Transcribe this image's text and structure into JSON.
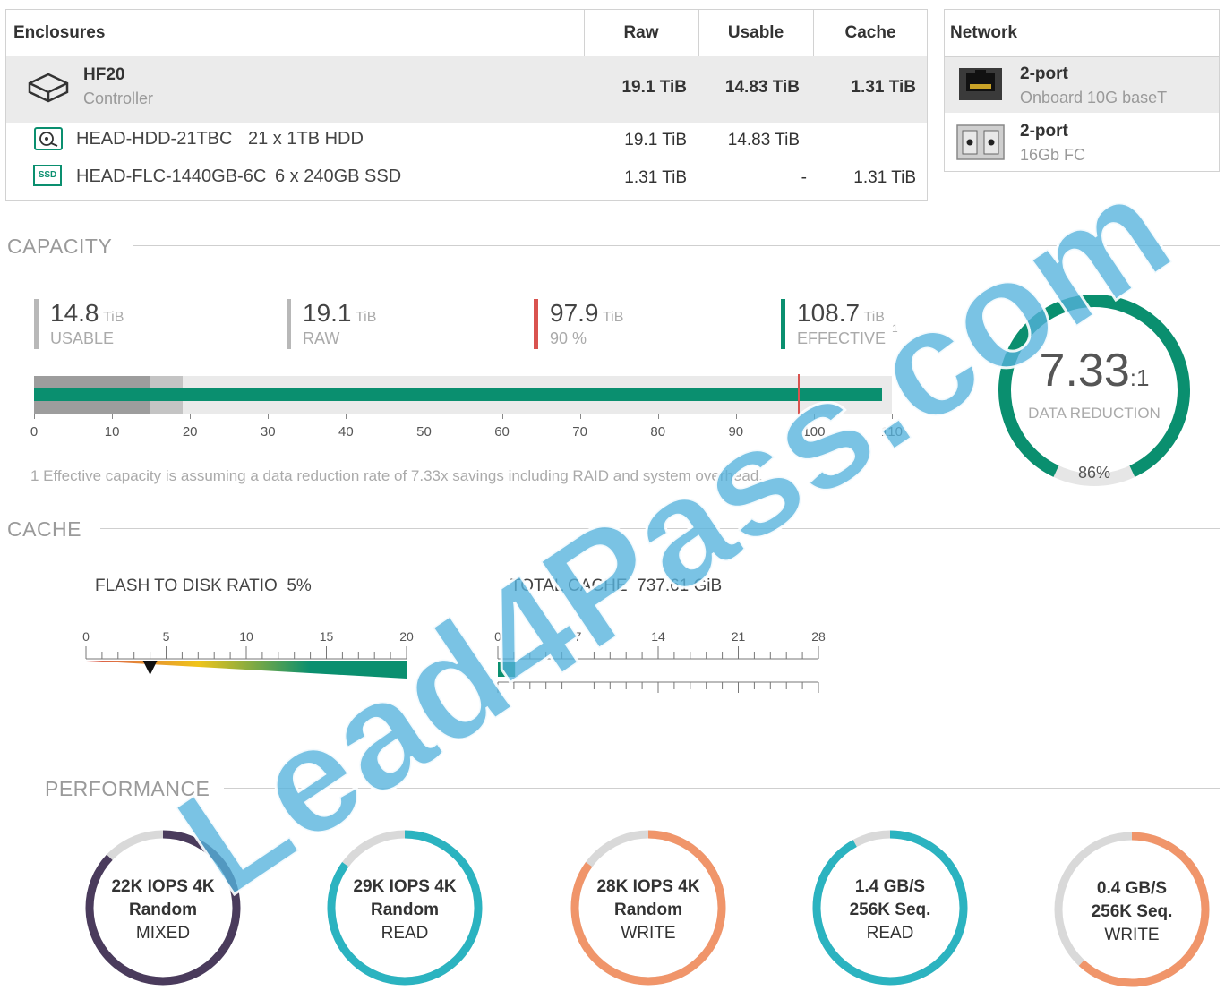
{
  "enclosures": {
    "header": {
      "name": "Enclosures",
      "raw": "Raw",
      "usable": "Usable",
      "cache": "Cache"
    },
    "controller": {
      "title": "HF20",
      "subtitle": "Controller",
      "raw": "19.1 TiB",
      "usable": "14.83 TiB",
      "cache": "1.31 TiB"
    },
    "drives": [
      {
        "icon": "hdd-icon",
        "name": "HEAD-HDD-21TBC",
        "desc": "21 x 1TB HDD",
        "raw": "19.1 TiB",
        "usable": "14.83 TiB",
        "cache": ""
      },
      {
        "icon": "ssd-icon",
        "icon_text": "SSD",
        "name": "HEAD-FLC-1440GB-6C",
        "desc": "6 x 240GB SSD",
        "raw": "1.31 TiB",
        "usable": "-",
        "cache": "1.31 TiB"
      }
    ]
  },
  "network": {
    "header": "Network",
    "items": [
      {
        "icon": "ethernet-port-icon",
        "title": "2-port",
        "subtitle": "Onboard 10G baseT"
      },
      {
        "icon": "fc-port-icon",
        "title": "2-port",
        "subtitle": "16Gb FC"
      }
    ]
  },
  "capacity": {
    "title": "CAPACITY",
    "stats": [
      {
        "value": "14.8",
        "unit": "TiB",
        "label": "USABLE",
        "color": "#b8b8b8"
      },
      {
        "value": "19.1",
        "unit": "TiB",
        "label": "RAW",
        "color": "#b8b8b8"
      },
      {
        "value": "97.9",
        "unit": "TiB",
        "label": "90 %",
        "color": "#d9534f"
      },
      {
        "value": "108.7",
        "unit": "TiB",
        "label": "EFFECTIVE",
        "marker": "1",
        "color": "#0a8f6f"
      }
    ],
    "bar": {
      "usable": 14.8,
      "raw": 19.1,
      "threshold": 97.9,
      "effective": 108.7,
      "max": 110
    },
    "ticks": [
      "0",
      "10",
      "20",
      "30",
      "40",
      "50",
      "60",
      "70",
      "80",
      "90",
      "100",
      "110"
    ],
    "footnote": "1 Effective capacity is assuming a data reduction rate of 7.33x savings including RAID and system overhead.",
    "reduction": {
      "ratio": "7.33",
      "suffix": ":1",
      "label": "DATA REDUCTION",
      "percent": "86%",
      "fraction": 0.86
    }
  },
  "cache": {
    "title": "CACHE",
    "flash_label": "FLASH TO DISK RATIO",
    "flash_value": "5%",
    "flash_ticks": [
      "0",
      "5",
      "10",
      "15",
      "20"
    ],
    "flash_marker": 4,
    "total_label": "TOTAL CACHE",
    "total_value": "737.61 GiB",
    "total_ticks": [
      "0",
      "7",
      "14",
      "21",
      "28"
    ],
    "total_fill": 0.72
  },
  "performance": {
    "title": "PERFORMANCE",
    "items": [
      {
        "line1": "22K IOPS 4K",
        "line2": "Random",
        "line3": "MIXED",
        "color": "#4a3b5c",
        "fraction": 0.87
      },
      {
        "line1": "29K IOPS 4K",
        "line2": "Random",
        "line3": "READ",
        "color": "#2bb3c0",
        "fraction": 0.85
      },
      {
        "line1": "28K IOPS 4K",
        "line2": "Random",
        "line3": "WRITE",
        "color": "#f0956a",
        "fraction": 0.85
      },
      {
        "line1": "1.4 GB/S",
        "line2": "256K Seq.",
        "line3": "READ",
        "color": "#2bb3c0",
        "fraction": 0.92
      },
      {
        "line1": "0.4 GB/S",
        "line2": "256K Seq.",
        "line3": "WRITE",
        "color": "#f0956a",
        "fraction": 0.62
      }
    ]
  },
  "watermark": "Lead4Pass.com"
}
